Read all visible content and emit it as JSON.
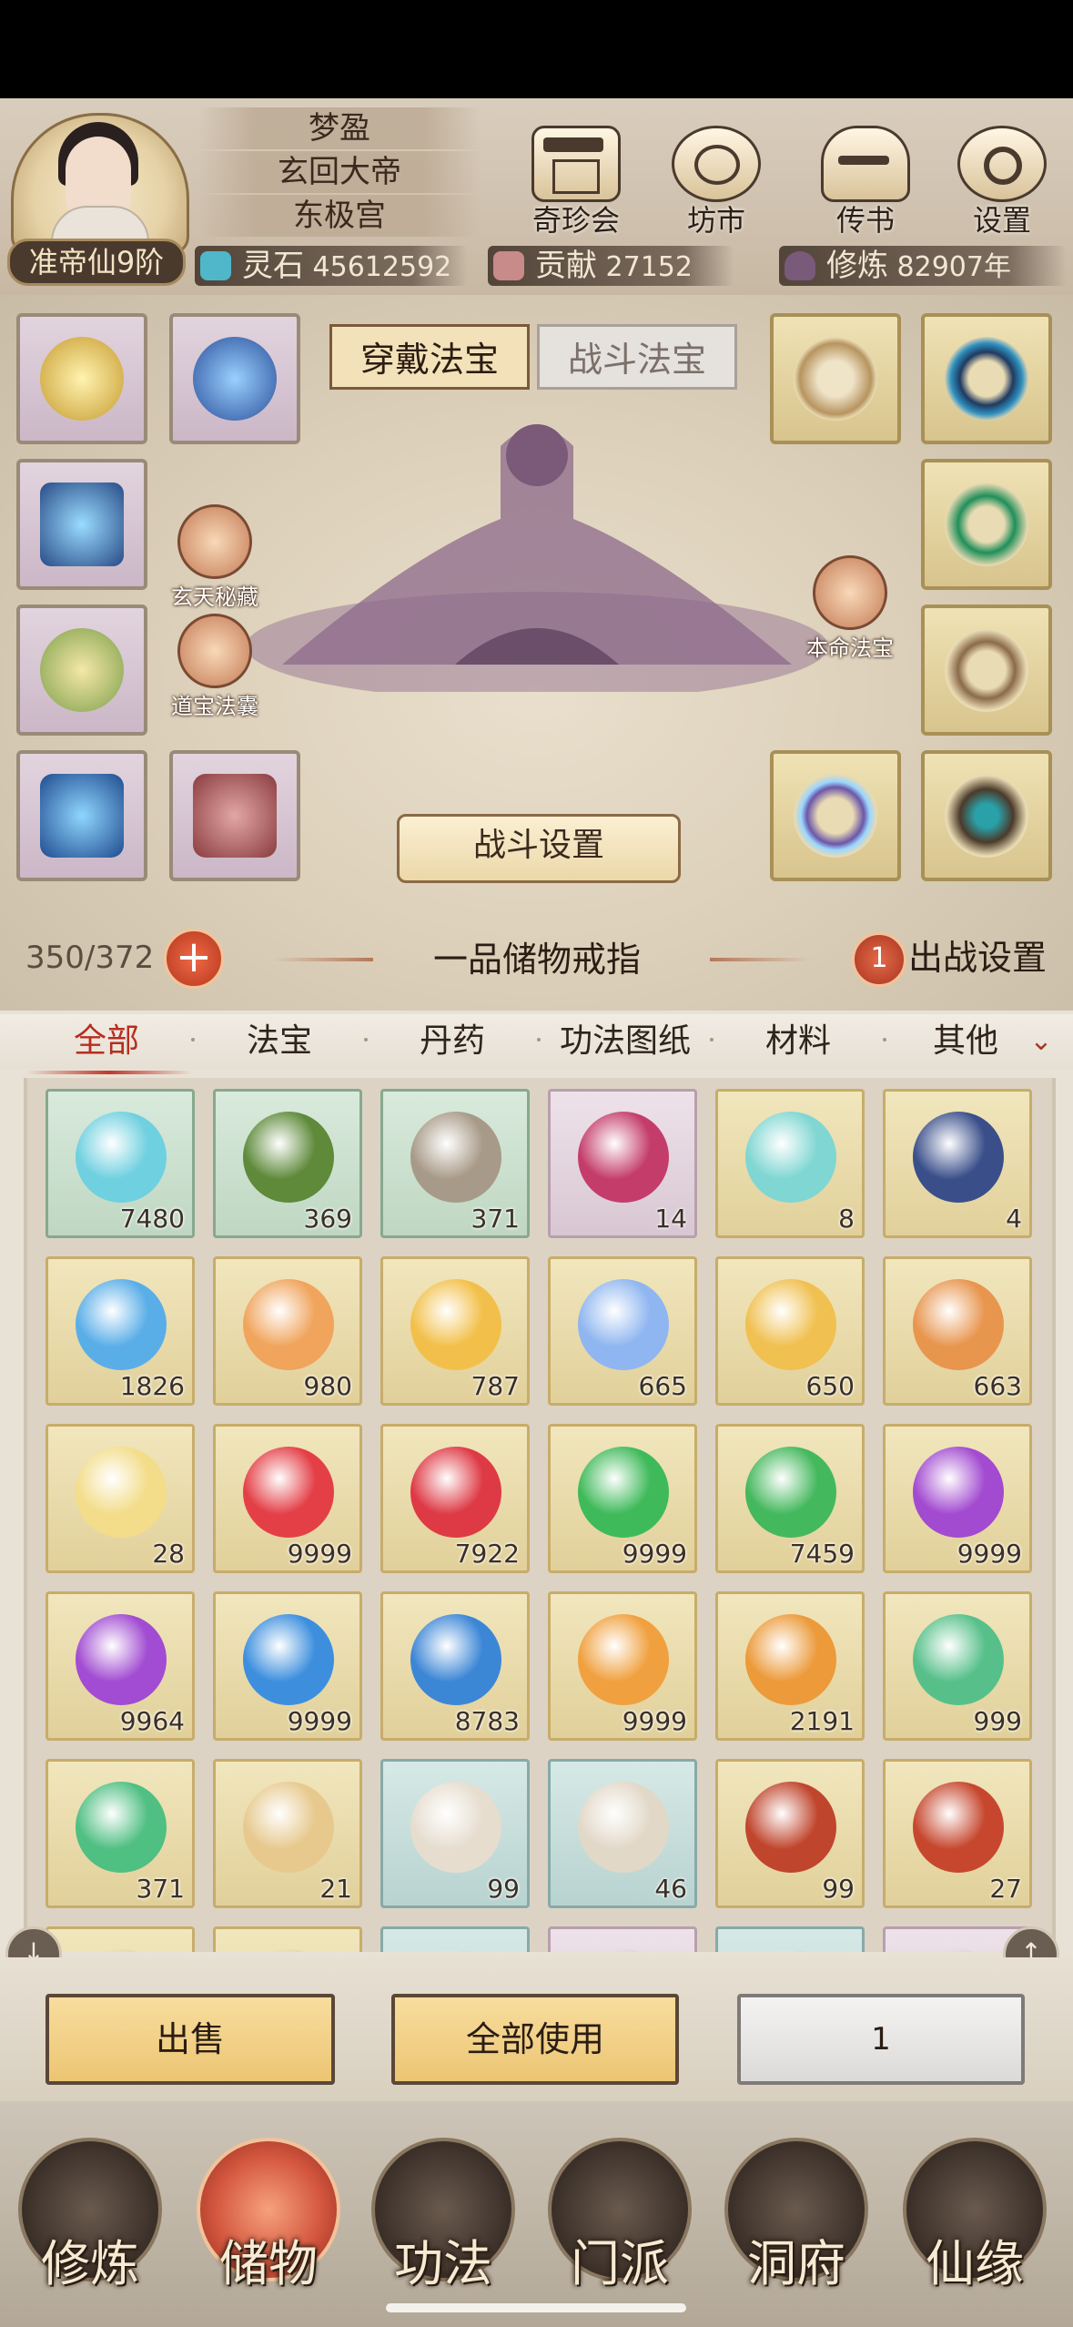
{
  "player": {
    "rank_badge": "准帝仙9阶",
    "name_lines": [
      "梦盈",
      "玄回大帝",
      "东极宫"
    ]
  },
  "top_menu": [
    {
      "label": "奇珍会",
      "icon": "treasure-pavilion-icon"
    },
    {
      "label": "坊市",
      "icon": "market-icon"
    },
    {
      "label": "传书",
      "icon": "scroll-letter-icon"
    },
    {
      "label": "设置",
      "icon": "gear-icon"
    }
  ],
  "resources": {
    "spirit_stone": {
      "label": "灵石",
      "value": "45612592",
      "color": "#4fb7c9"
    },
    "contribution": {
      "label": "贡献",
      "value": "27152",
      "color": "#c98a8a"
    },
    "cultivation": {
      "label": "修炼",
      "value": "82907年",
      "color": "#7a5a7a"
    }
  },
  "equip_tabs": {
    "wear": "穿戴法宝",
    "battle": "战斗法宝"
  },
  "side_buttons": {
    "xuantian": "玄天秘藏",
    "daobao": "道宝法囊",
    "benming": "本命法宝"
  },
  "battle_settings_label": "战斗设置",
  "ring": {
    "capacity": "350/372",
    "add_symbol": "+",
    "title": "一品储物戒指",
    "battle_count": "1",
    "battle_setup_label": "出战设置"
  },
  "filters": [
    "全部",
    "法宝",
    "丹药",
    "功法图纸",
    "材料",
    "其他"
  ],
  "active_filter": "全部",
  "items": [
    {
      "qty": "7480",
      "frame": "green",
      "color": "#6fd0e0"
    },
    {
      "qty": "369",
      "frame": "green",
      "color": "#5e8a3a"
    },
    {
      "qty": "371",
      "frame": "green",
      "color": "#a89a88"
    },
    {
      "qty": "14",
      "frame": "purple",
      "color": "#c43d6a"
    },
    {
      "qty": "8",
      "frame": "gold",
      "color": "#7fd6d2"
    },
    {
      "qty": "4",
      "frame": "gold",
      "color": "#3a4f8a"
    },
    {
      "qty": "1826",
      "frame": "gold",
      "color": "#5aaee8"
    },
    {
      "qty": "980",
      "frame": "gold",
      "color": "#f0a45c"
    },
    {
      "qty": "787",
      "frame": "gold",
      "color": "#f2c04a"
    },
    {
      "qty": "665",
      "frame": "gold",
      "color": "#8fb6f0"
    },
    {
      "qty": "650",
      "frame": "gold",
      "color": "#f0c050"
    },
    {
      "qty": "663",
      "frame": "gold",
      "color": "#e8954e"
    },
    {
      "qty": "28",
      "frame": "gold",
      "color": "#f3dd8a"
    },
    {
      "qty": "9999",
      "frame": "gold",
      "color": "#e43f47"
    },
    {
      "qty": "7922",
      "frame": "gold",
      "color": "#de3a45"
    },
    {
      "qty": "9999",
      "frame": "gold",
      "color": "#3fba5a"
    },
    {
      "qty": "7459",
      "frame": "gold",
      "color": "#44b85d"
    },
    {
      "qty": "9999",
      "frame": "gold",
      "color": "#a24ad0"
    },
    {
      "qty": "9964",
      "frame": "gold",
      "color": "#a14cd2"
    },
    {
      "qty": "9999",
      "frame": "gold",
      "color": "#3d8fde"
    },
    {
      "qty": "8783",
      "frame": "gold",
      "color": "#3c86d6"
    },
    {
      "qty": "9999",
      "frame": "gold",
      "color": "#f0a03e"
    },
    {
      "qty": "2191",
      "frame": "gold",
      "color": "#ec9a3a"
    },
    {
      "qty": "999",
      "frame": "gold",
      "color": "#57c08a"
    },
    {
      "qty": "371",
      "frame": "gold",
      "color": "#4fbf82"
    },
    {
      "qty": "21",
      "frame": "gold",
      "color": "#e7c98e"
    },
    {
      "qty": "99",
      "frame": "teal",
      "color": "#e6ddcf"
    },
    {
      "qty": "46",
      "frame": "teal",
      "color": "#e2d8c8"
    },
    {
      "qty": "99",
      "frame": "gold",
      "color": "#c0452d"
    },
    {
      "qty": "27",
      "frame": "gold",
      "color": "#c6472e"
    },
    {
      "qty": "",
      "frame": "gold",
      "color": "#e8d9a8"
    },
    {
      "qty": "",
      "frame": "gold",
      "color": "#e8d9a8"
    },
    {
      "qty": "",
      "frame": "teal",
      "color": "#cfe2df"
    },
    {
      "qty": "",
      "frame": "purple",
      "color": "#e3d5df"
    },
    {
      "qty": "",
      "frame": "teal",
      "color": "#cfe2df"
    },
    {
      "qty": "",
      "frame": "purple",
      "color": "#e3d5df"
    }
  ],
  "actions": {
    "sell": "出售",
    "use_all": "全部使用",
    "quantity": "1"
  },
  "nav": [
    {
      "label": "修炼",
      "icon": "cultivation-icon"
    },
    {
      "label": "储物",
      "icon": "storage-bag-icon"
    },
    {
      "label": "功法",
      "icon": "technique-scroll-icon"
    },
    {
      "label": "门派",
      "icon": "sect-gate-icon"
    },
    {
      "label": "洞府",
      "icon": "cave-abode-icon"
    },
    {
      "label": "仙缘",
      "icon": "immortal-fate-icon"
    }
  ],
  "active_nav": "储物",
  "colors": {
    "accent_red": "#b82d1e",
    "gold_frame": "#c7ad6a",
    "header_bg": "#d9cdbd"
  }
}
